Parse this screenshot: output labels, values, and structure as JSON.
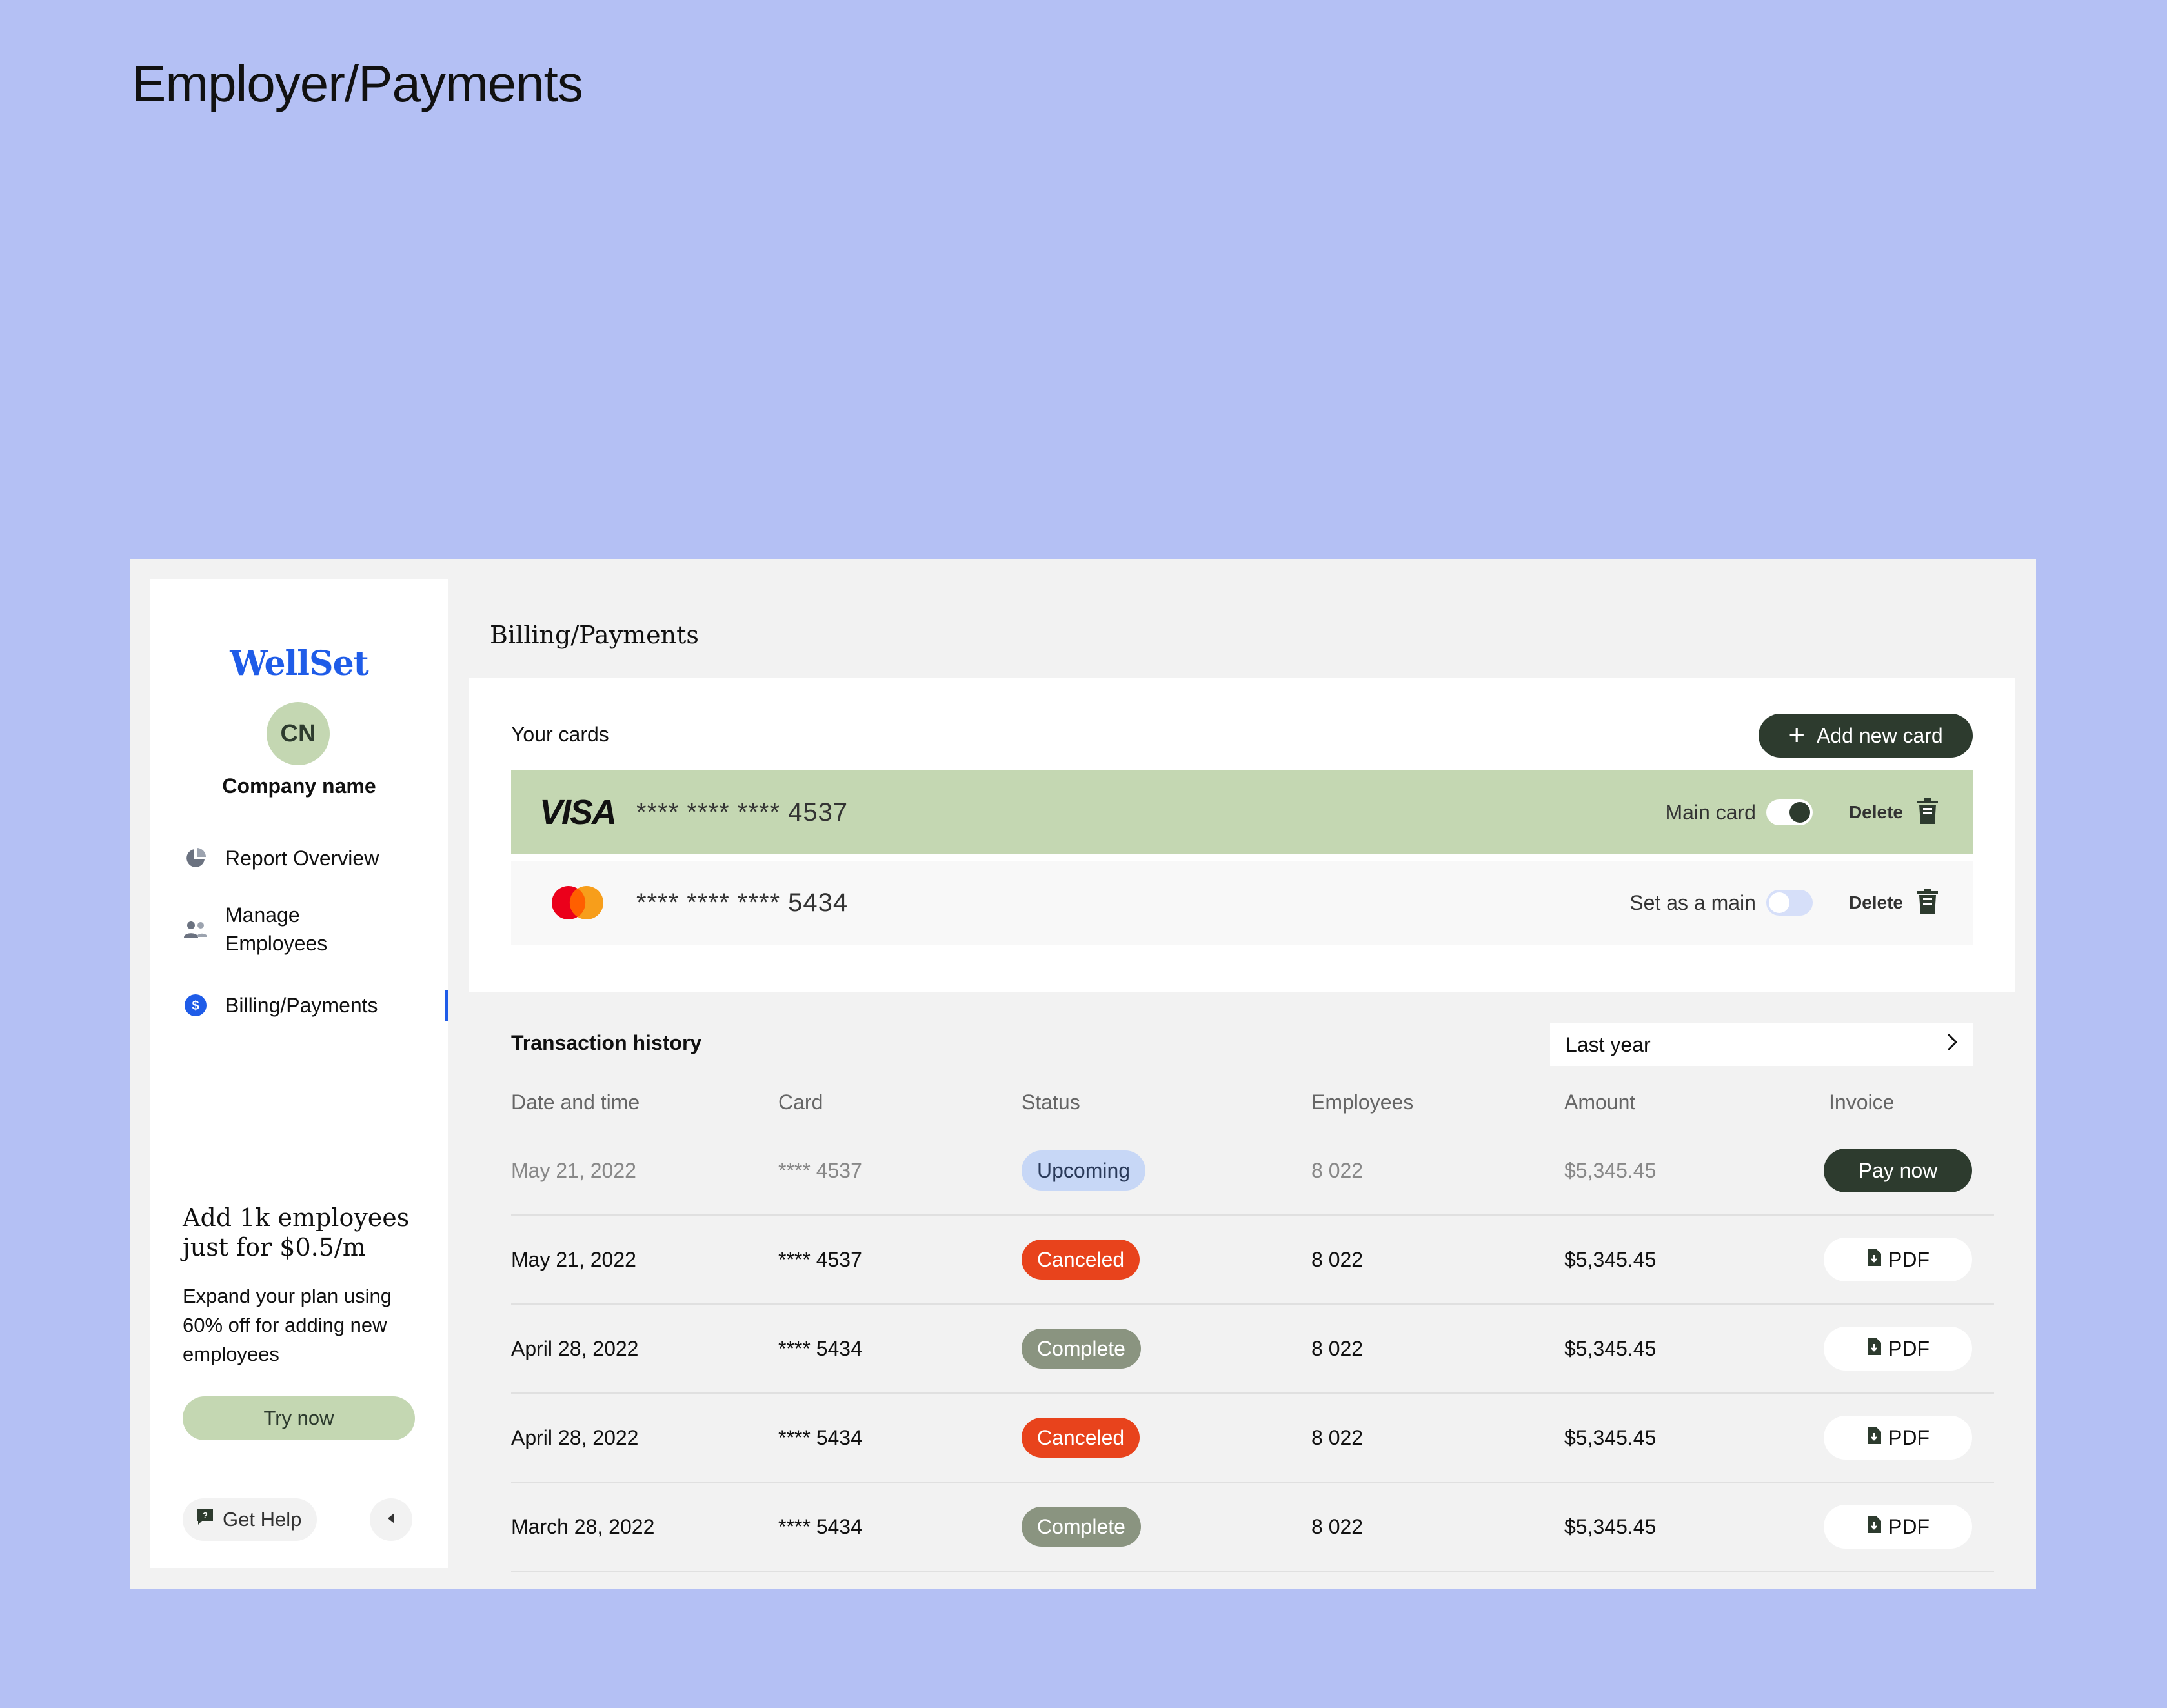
{
  "page": {
    "heading": "Employer/Payments"
  },
  "sidebar": {
    "logo": "WellSet",
    "avatar_initials": "CN",
    "company_name": "Company name",
    "nav": [
      {
        "label": "Report Overview",
        "icon": "pie-chart-icon"
      },
      {
        "label": "Manage\nEmployees",
        "icon": "people-icon"
      },
      {
        "label": "Billing/Payments",
        "icon": "dollar-circle-icon",
        "active": true
      }
    ],
    "promo": {
      "title": "Add 1k employees just for $0.5/m",
      "text": "Expand your plan using 60% off for adding new employees",
      "button": "Try now"
    },
    "help": "Get Help"
  },
  "main": {
    "title": "Billing/Payments",
    "cards": {
      "label": "Your cards",
      "add_button": "Add new card",
      "items": [
        {
          "brand": "VISA",
          "number": "**** **** **** 4537",
          "control_label": "Main card",
          "is_main": true,
          "delete": "Delete"
        },
        {
          "brand": "mastercard",
          "number": "**** **** **** 5434",
          "control_label": "Set as a main",
          "is_main": false,
          "delete": "Delete"
        }
      ]
    },
    "transactions": {
      "title": "Transaction history",
      "period": "Last year",
      "columns": [
        "Date and time",
        "Card",
        "Status",
        "Employees",
        "Amount",
        "Invoice"
      ],
      "rows": [
        {
          "date": "May 21, 2022",
          "card": "**** 4537",
          "status": "Upcoming",
          "employees": "8 022",
          "amount": "$5,345.45",
          "invoice": "Pay now"
        },
        {
          "date": "May 21, 2022",
          "card": "**** 4537",
          "status": "Canceled",
          "employees": "8 022",
          "amount": "$5,345.45",
          "invoice": "PDF"
        },
        {
          "date": "April 28, 2022",
          "card": "**** 5434",
          "status": "Complete",
          "employees": "8 022",
          "amount": "$5,345.45",
          "invoice": "PDF"
        },
        {
          "date": "April 28, 2022",
          "card": "**** 5434",
          "status": "Canceled",
          "employees": "8 022",
          "amount": "$5,345.45",
          "invoice": "PDF"
        },
        {
          "date": "March 28, 2022",
          "card": "**** 5434",
          "status": "Complete",
          "employees": "8 022",
          "amount": "$5,345.45",
          "invoice": "PDF"
        }
      ]
    }
  },
  "colors": {
    "background": "#b4c0f4",
    "brand_blue": "#1f5ce8",
    "dark_green": "#2d3b2e",
    "light_green": "#c4d7b2",
    "canceled": "#e8431c",
    "complete": "#8a9480",
    "upcoming": "#c7d7f6"
  }
}
